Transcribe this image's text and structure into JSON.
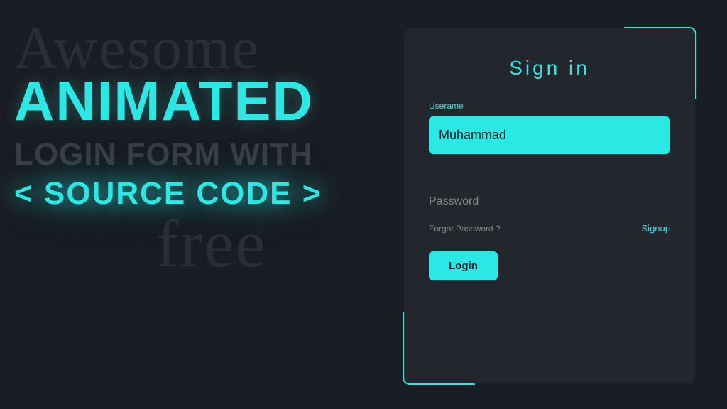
{
  "decorative": {
    "awesome": "Awesome",
    "animated": "ANIMATED",
    "login_form_with": "LOGIN FORM WITH",
    "source_code": "< SOURCE CODE >",
    "free": "free"
  },
  "form": {
    "title": "Sign in",
    "username_label": "Userame",
    "username_value": "Muhammad",
    "password_placeholder": "Password",
    "forgot_link": "Forgot Password ?",
    "signup_link": "Signup",
    "login_button": "Login"
  }
}
